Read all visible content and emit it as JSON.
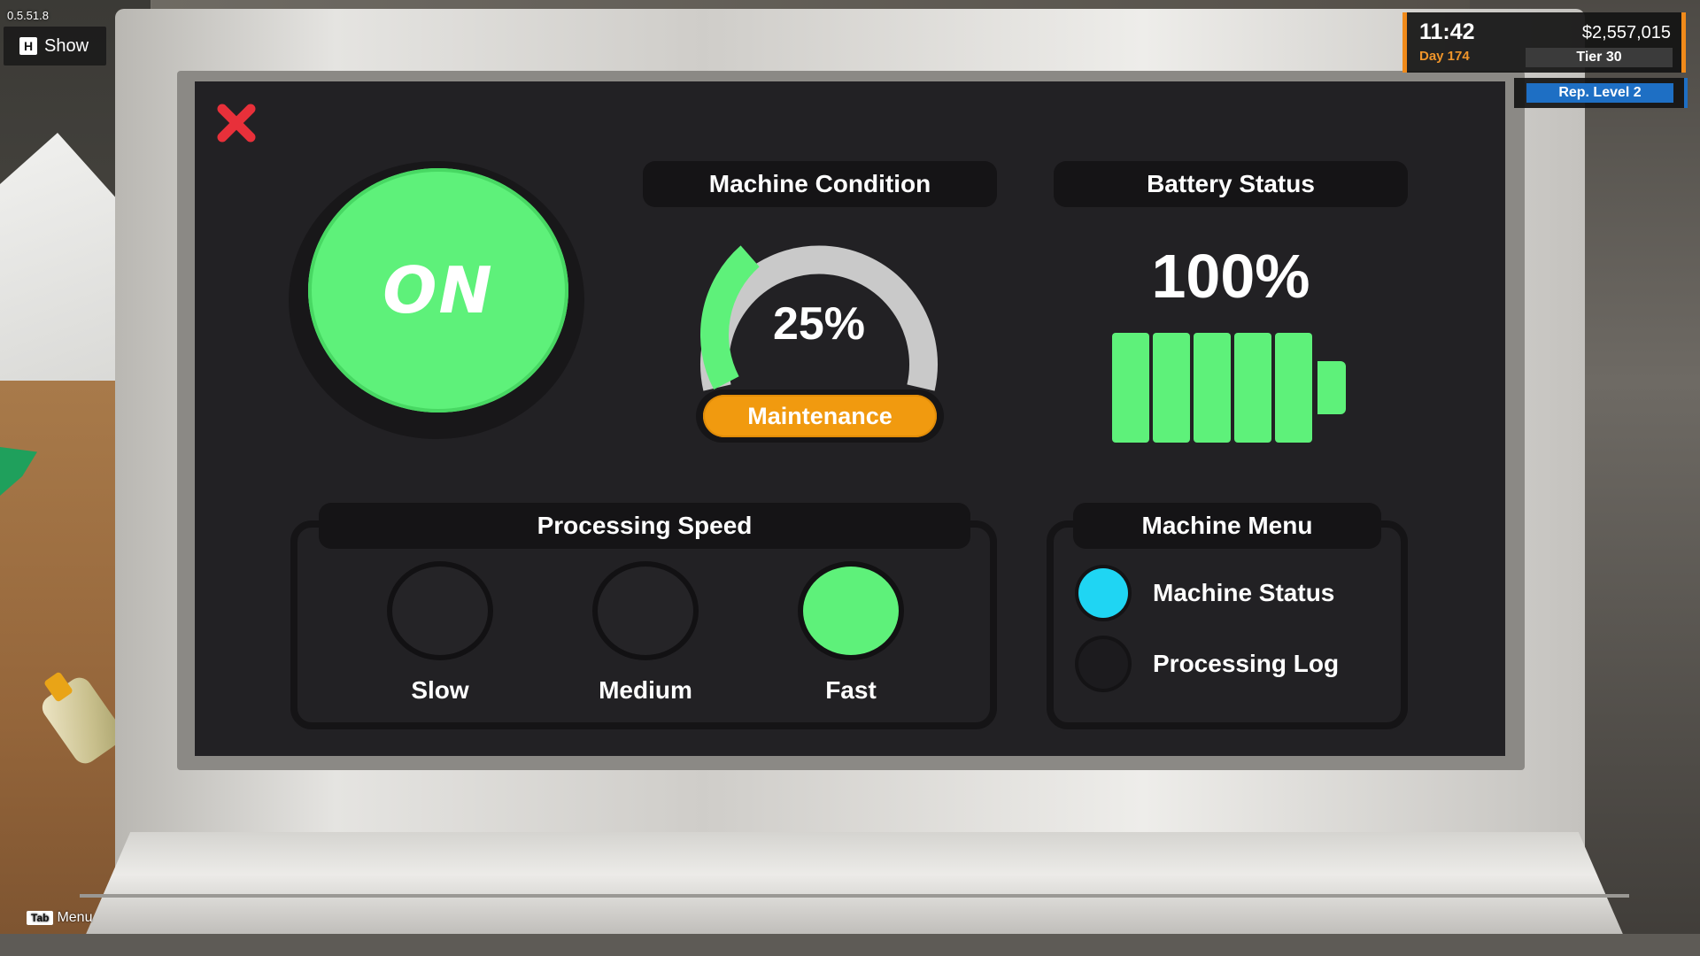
{
  "hud": {
    "version": "0.5.51.8",
    "show_key": "H",
    "show_label": "Show",
    "time": "11:42",
    "day": "Day 174",
    "money": "$2,557,015",
    "tier": "Tier 30",
    "reputation": "Rep. Level 2",
    "menu_key": "Tab",
    "menu_label": "Menu"
  },
  "machine": {
    "power_label": "ON",
    "condition": {
      "title": "Machine Condition",
      "value_text": "25%",
      "value": 0.25,
      "action_label": "Maintenance"
    },
    "battery": {
      "title": "Battery Status",
      "value_text": "100%",
      "level": 1.0,
      "cells": 5
    },
    "speed": {
      "title": "Processing Speed",
      "options": [
        "Slow",
        "Medium",
        "Fast"
      ],
      "selected": "Fast"
    },
    "menu": {
      "title": "Machine Menu",
      "items": [
        "Machine Status",
        "Processing Log"
      ],
      "selected": "Machine Status"
    }
  },
  "colors": {
    "accent_green": "#5ef17a",
    "maintenance_orange": "#f19a0f",
    "menu_active_cyan": "#1fd5f3",
    "close_red": "#e8303a",
    "screen_bg": "#222124",
    "hud_orange": "#f08a1a",
    "rep_blue": "#1e6fc4"
  },
  "icons": {
    "close": "close-icon"
  }
}
